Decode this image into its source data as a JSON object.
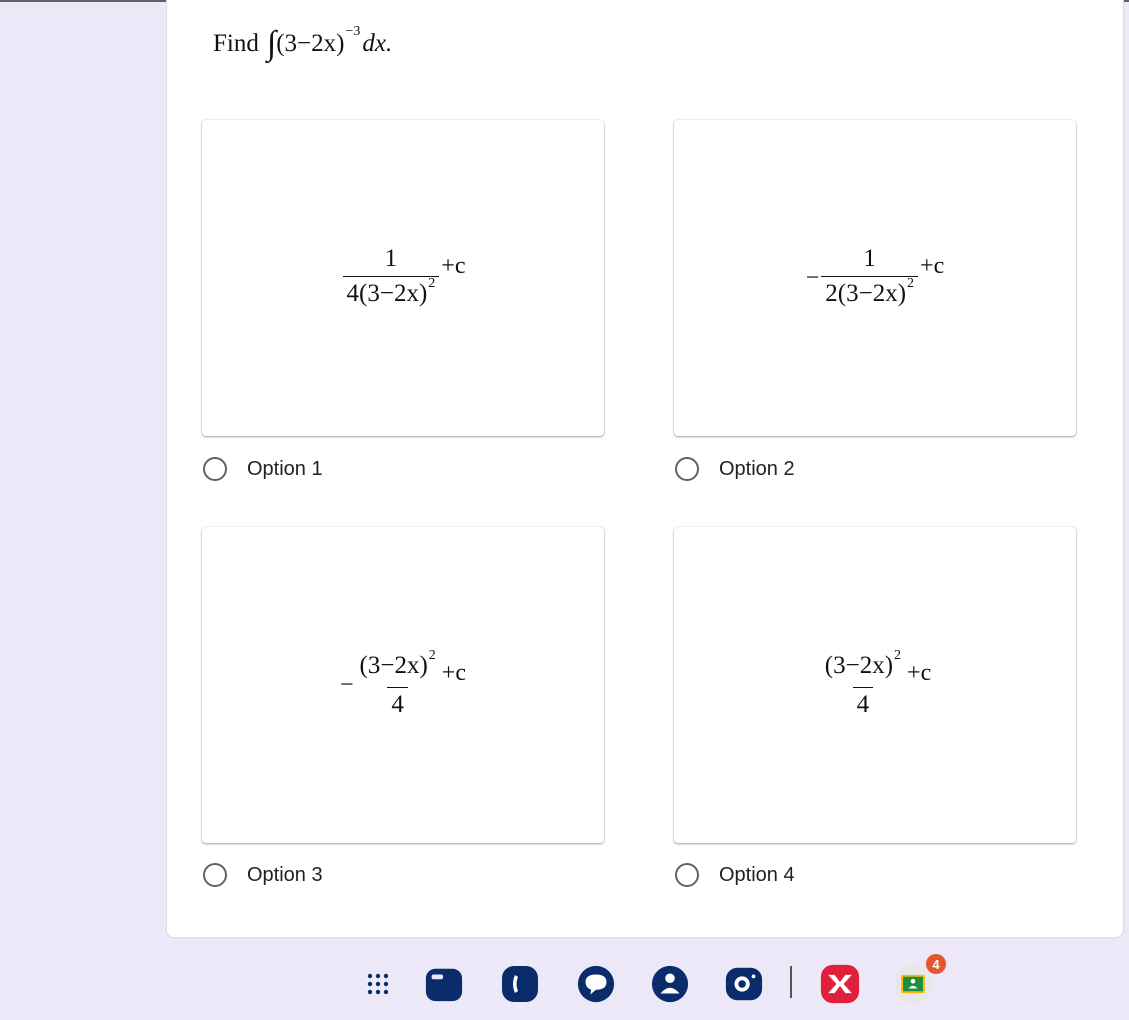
{
  "question": {
    "find_label": "Find",
    "integral_sign": "∫",
    "base": "(3−2x)",
    "exponent": "−3",
    "dx": "dx."
  },
  "options": [
    {
      "label": "Option 1",
      "numerator": "1",
      "denominator_coef": "4",
      "denominator_base": "(3−2x)",
      "denominator_exp": "2",
      "sign": "",
      "suffix": "+c"
    },
    {
      "label": "Option 2",
      "numerator": "1",
      "denominator_coef": "2",
      "denominator_base": "(3−2x)",
      "denominator_exp": "2",
      "sign": "−",
      "suffix": "+c"
    },
    {
      "label": "Option 3",
      "numerator_base": "(3−2x)",
      "numerator_exp": "2",
      "denominator": "4",
      "sign": "−",
      "suffix": "+c"
    },
    {
      "label": "Option 4",
      "numerator_base": "(3−2x)",
      "numerator_exp": "2",
      "denominator": "4",
      "sign": "",
      "suffix": "+c"
    }
  ],
  "taskbar": {
    "apps": [
      "app-grid-icon",
      "files-icon",
      "phone-icon",
      "messages-icon",
      "contacts-icon",
      "camera-icon",
      "xodo-app-icon",
      "google-classroom-icon"
    ],
    "classroom_badge": "4"
  },
  "colors": {
    "background": "#ede8f7",
    "card": "#ffffff",
    "radio_border": "#5f6368",
    "taskbar_blue": "#0b2c6b",
    "xodo_red": "#e0203a",
    "badge": "#e4572e"
  }
}
